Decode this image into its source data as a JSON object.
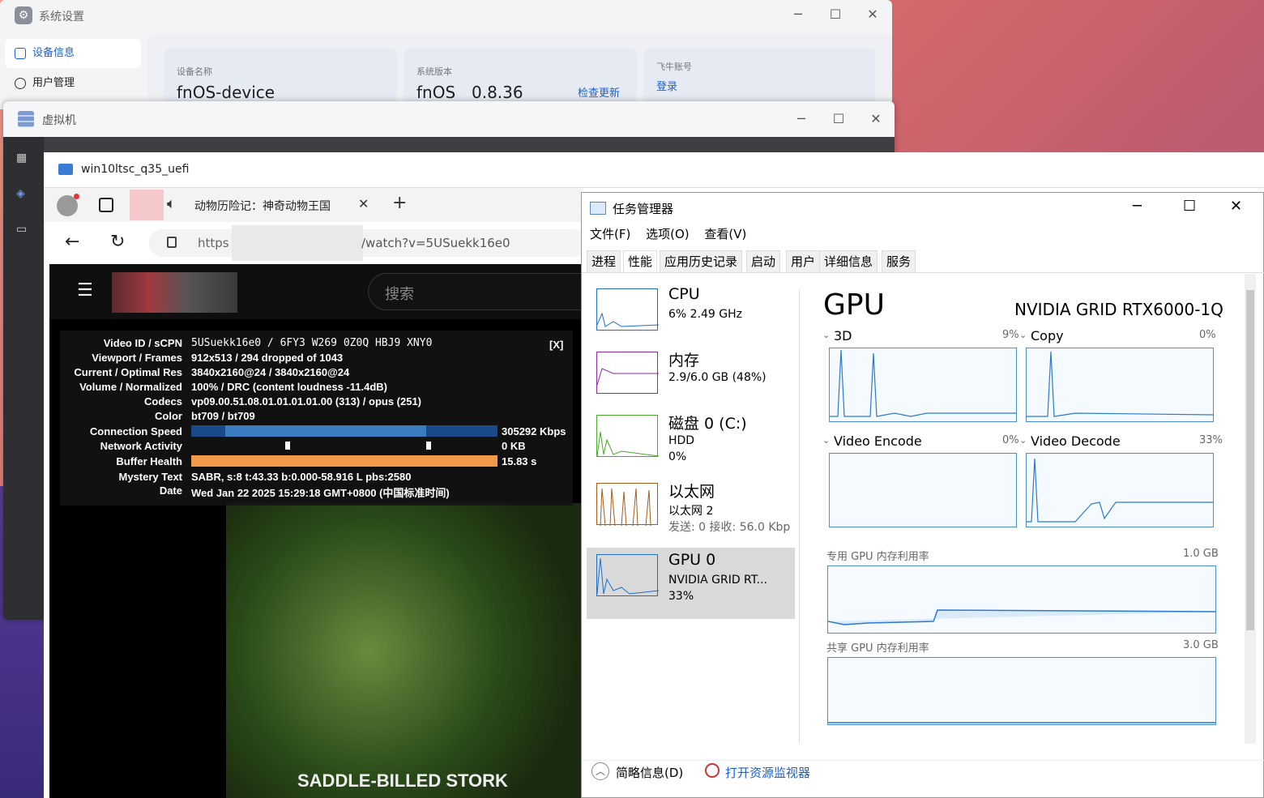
{
  "sys_settings": {
    "title": "系统设置",
    "sidebar": [
      "设备信息",
      "用户管理"
    ],
    "cards": [
      {
        "label": "设备名称",
        "value": "fnOS-device"
      },
      {
        "label": "系统版本",
        "value": "fnOS",
        "value2": "0.8.36",
        "link": "检查更新"
      },
      {
        "label": "飞牛账号",
        "link": "登录"
      }
    ]
  },
  "vm": {
    "title": "虚拟机"
  },
  "win10": {
    "title": "win10ltsc_q35_uefi"
  },
  "edge": {
    "tab_title": "动物历险记：神奇动物王国",
    "url_prefix": "https",
    "url_suffix": "/watch?v=5USuekk16e0"
  },
  "youtube": {
    "search_placeholder": "搜索",
    "close_label": "[X]",
    "video_caption": "SADDLE-BILLED STORK",
    "stats": [
      {
        "k": "Video ID / sCPN",
        "v": "5USuekk16e0 / 6FY3 W269 0Z0Q HBJ9 XNY0"
      },
      {
        "k": "Viewport / Frames",
        "v": "912x513 / 294 dropped of 1043"
      },
      {
        "k": "Current / Optimal Res",
        "v": "3840x2160@24 / 3840x2160@24"
      },
      {
        "k": "Volume / Normalized",
        "v": "100% / DRC (content loudness -11.4dB)"
      },
      {
        "k": "Codecs",
        "v": "vp09.00.51.08.01.01.01.01.00 (313) / opus (251)"
      },
      {
        "k": "Color",
        "v": "bt709 / bt709"
      },
      {
        "k": "Connection Speed",
        "v": "305292 Kbps"
      },
      {
        "k": "Network Activity",
        "v": "0 KB"
      },
      {
        "k": "Buffer Health",
        "v": "15.83 s"
      },
      {
        "k": "Mystery Text",
        "v": "SABR, s:8 t:43.33 b:0.000-58.916 L pbs:2580"
      },
      {
        "k": "Date",
        "v": "Wed Jan 22 2025 15:29:18 GMT+0800 (中国标准时间)"
      }
    ]
  },
  "taskmgr": {
    "title": "任务管理器",
    "menu": [
      "文件(F)",
      "选项(O)",
      "查看(V)"
    ],
    "tabs": [
      "进程",
      "性能",
      "应用历史记录",
      "启动",
      "用户",
      "详细信息",
      "服务"
    ],
    "active_tab": "性能",
    "perf_items": [
      {
        "name": "CPU",
        "l2": "6% 2.49 GHz",
        "l3": "",
        "color": "#1f6fc5"
      },
      {
        "name": "内存",
        "l2": "2.9/6.0 GB (48%)",
        "l3": "",
        "color": "#8b2ca0"
      },
      {
        "name": "磁盘 0 (C:)",
        "l2": "HDD",
        "l3": "0%",
        "color": "#4aa92a"
      },
      {
        "name": "以太网",
        "l2": "以太网 2",
        "l3": "发送: 0 接收: 56.0 Kbp",
        "color": "#a75c1a"
      },
      {
        "name": "GPU 0",
        "l2": "NVIDIA GRID RT...",
        "l3": "33%",
        "color": "#1f6fc5"
      }
    ],
    "gpu_title": "GPU",
    "gpu_model": "NVIDIA GRID RTX6000-1Q",
    "engines": [
      {
        "name": "3D",
        "pct": "9%"
      },
      {
        "name": "Copy",
        "pct": "0%"
      },
      {
        "name": "Video Encode",
        "pct": "0%"
      },
      {
        "name": "Video Decode",
        "pct": "33%"
      }
    ],
    "dedicated_label": "专用 GPU 内存利用率",
    "dedicated_max": "1.0 GB",
    "shared_label": "共享 GPU 内存利用率",
    "shared_max": "3.0 GB",
    "footer_less": "简略信息(D)",
    "footer_monitor": "打开资源监视器"
  }
}
